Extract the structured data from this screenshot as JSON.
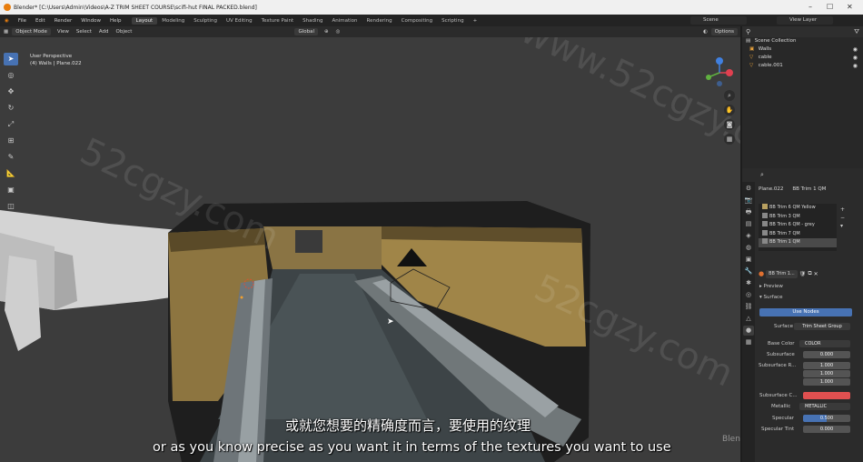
{
  "window": {
    "title": "Blender* [C:\\Users\\Admin\\Videos\\A-Z TRIM SHEET COURSE\\scifi-hut FINAL PACKED.blend]"
  },
  "menubar": {
    "menus": [
      "File",
      "Edit",
      "Render",
      "Window",
      "Help"
    ],
    "workspaces": [
      "Layout",
      "Modeling",
      "Sculpting",
      "UV Editing",
      "Texture Paint",
      "Shading",
      "Animation",
      "Rendering",
      "Compositing",
      "Scripting"
    ],
    "active_workspace": "Layout",
    "scene": "Scene",
    "view_layer": "View Layer"
  },
  "viewport_header": {
    "mode": "Object Mode",
    "menus": [
      "View",
      "Select",
      "Add",
      "Object"
    ],
    "transform_orientation": "Global",
    "options": "Options"
  },
  "viewport": {
    "perspective": "User Perspective",
    "active_object": "(4) Walls | Plane.022"
  },
  "outliner": {
    "root": "Scene Collection",
    "items": [
      {
        "name": "Walls",
        "icon": "collection-icon"
      },
      {
        "name": "cable",
        "icon": "object-icon"
      },
      {
        "name": "cable.001",
        "icon": "object-icon"
      }
    ]
  },
  "properties": {
    "object_name": "Plane.022",
    "material_name": "BB Trim 1 QM",
    "material_slots": [
      "BB Trim 6 QM Yellow",
      "BB Trim 3 QM",
      "BB Trim 6 QM - grey",
      "BB Trim 7 QM",
      "BB Trim 1 QM"
    ],
    "selected_slot": "BB Trim 1 QM",
    "active_material_short": "BB Trim 1...",
    "sections": {
      "preview": "Preview",
      "surface": "Surface"
    },
    "use_nodes": "Use Nodes",
    "surface_label": "Surface",
    "surface_value": "Trim Sheet Group",
    "fields": [
      {
        "label": "Base Color",
        "value": "COLOR"
      },
      {
        "label": "Subsurface",
        "value": "0.000"
      },
      {
        "label": "Subsurface R...",
        "value": "1.000"
      },
      {
        "label": "",
        "value": "1.000"
      },
      {
        "label": "",
        "value": "1.000"
      },
      {
        "label": "Subsurface C...",
        "value": ""
      },
      {
        "label": "Metallic",
        "value": "METALLIC"
      },
      {
        "label": "Specular",
        "value": "0.500"
      },
      {
        "label": "Specular Tint",
        "value": "0.000"
      }
    ],
    "subsurface_color": "#e05050"
  },
  "subtitles": {
    "chinese": "或就您想要的精确度而言，要使用的纹理",
    "english": "or as you know precise as you want it in terms of the textures you want to use"
  },
  "watermarks": [
    "www.52cgzy.com",
    "52cgzy.com",
    "52cgzy.com"
  ],
  "overlay_logo": "Blender Bros",
  "colors": {
    "accent": "#4772b3",
    "ui_bg": "#2b2b2b",
    "viewport_bg": "#3c3c3c"
  }
}
